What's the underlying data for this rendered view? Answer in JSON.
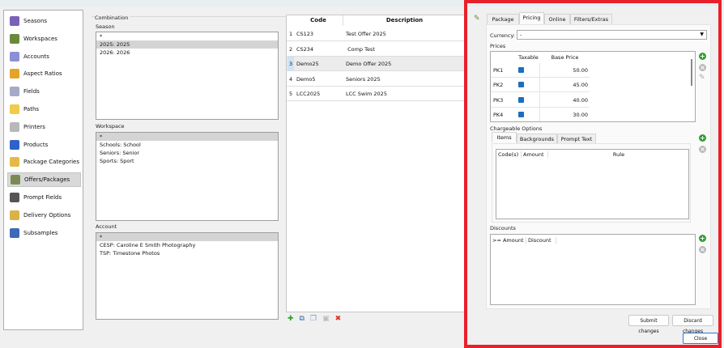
{
  "sidebar": {
    "items": [
      {
        "label": "Seasons",
        "icon": "calendar-icon",
        "color": "#7a62b8"
      },
      {
        "label": "Workspaces",
        "icon": "workspaces-icon",
        "color": "#6a8a3a"
      },
      {
        "label": "Accounts",
        "icon": "accounts-icon",
        "color": "#8d8fd6"
      },
      {
        "label": "Aspect Ratios",
        "icon": "aspect-ratio-icon",
        "color": "#e4a428"
      },
      {
        "label": "Fields",
        "icon": "fields-icon",
        "color": "#a7a9c9"
      },
      {
        "label": "Paths",
        "icon": "folder-icon",
        "color": "#f1cb4a"
      },
      {
        "label": "Printers",
        "icon": "printer-icon",
        "color": "#b8b8b8"
      },
      {
        "label": "Products",
        "icon": "products-icon",
        "color": "#2f62c8"
      },
      {
        "label": "Package Categories",
        "icon": "package-categories-icon",
        "color": "#e6b84a"
      },
      {
        "label": "Offers/Packages",
        "icon": "offers-icon",
        "color": "#7b8a55"
      },
      {
        "label": "Prompt Fields",
        "icon": "prompt-fields-icon",
        "color": "#555555"
      },
      {
        "label": "Delivery Options",
        "icon": "delivery-icon",
        "color": "#d9b24a"
      },
      {
        "label": "Subsamples",
        "icon": "subsamples-icon",
        "color": "#3d6ab8"
      }
    ],
    "selected": "Offers/Packages"
  },
  "combination": {
    "title": "Combination",
    "season": {
      "label": "Season",
      "items": [
        "*",
        "2025: 2025",
        "2026: 2026"
      ],
      "selected": "2025: 2025"
    },
    "workspace": {
      "label": "Workspace",
      "items": [
        "*",
        "Schools: School",
        "Seniors: Senior",
        "Sports: Sport"
      ],
      "selected": "*"
    },
    "account": {
      "label": "Account",
      "items": [
        "*",
        "CESP: Caroline E Smith Photography",
        "TSP: Timestone Photos"
      ],
      "selected": "*"
    }
  },
  "offers_grid": {
    "columns": [
      "Code",
      "Description"
    ],
    "rows": [
      {
        "n": "1",
        "code": "CS123",
        "desc": "Test Offer 2025"
      },
      {
        "n": "2",
        "code": "CS234",
        "desc": " Comp Test"
      },
      {
        "n": "3",
        "code": "Demo25",
        "desc": "Demo Offer 2025"
      },
      {
        "n": "4",
        "code": "Demo5",
        "desc": "Seniors 2025"
      },
      {
        "n": "5",
        "code": "LCC2025",
        "desc": "LCC Swim 2025"
      }
    ],
    "selected_row": "3"
  },
  "editor": {
    "tabs": [
      "Package",
      "Pricing",
      "Online",
      "Filters/Extras"
    ],
    "active_tab": "Pricing",
    "currency_label": "Currency:",
    "currency_value": "-",
    "prices": {
      "label": "Prices",
      "columns": [
        "",
        "Taxable",
        "Base Price"
      ],
      "rows": [
        {
          "name": "PK1",
          "taxable": true,
          "price": "50.00"
        },
        {
          "name": "PK2",
          "taxable": true,
          "price": "45.00"
        },
        {
          "name": "PK3",
          "taxable": true,
          "price": "40.00"
        },
        {
          "name": "PK4",
          "taxable": true,
          "price": "30.00"
        }
      ]
    },
    "chargeable": {
      "label": "Chargeable Options",
      "tabs": [
        "Items",
        "Backgrounds",
        "Prompt Text"
      ],
      "active_tab": "Items",
      "columns": [
        "Code(s)",
        "Amount",
        "Rule"
      ]
    },
    "discounts": {
      "label": "Discounts",
      "columns": [
        ">= Amount",
        "Discount"
      ]
    },
    "submit": "Submit changes",
    "discard": "Discard changes",
    "close": "Close"
  },
  "colors": {
    "highlight": "#e8202a",
    "checkbox": "#1b6ec2"
  }
}
